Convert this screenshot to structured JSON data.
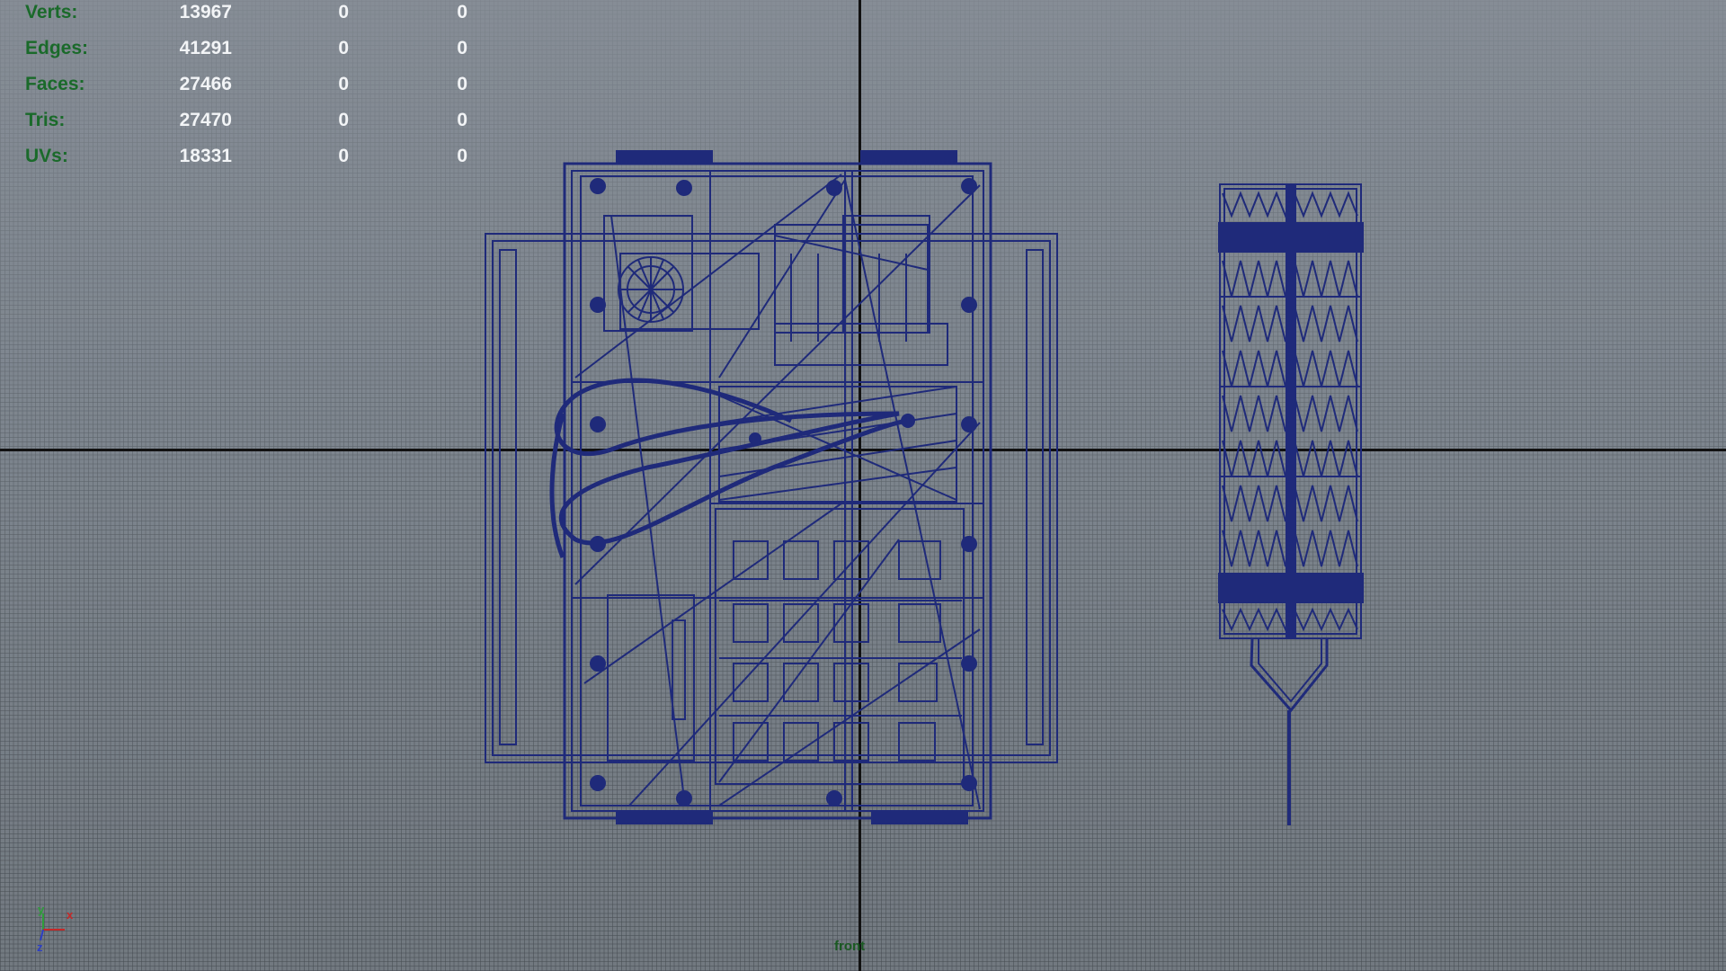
{
  "stats": [
    {
      "label": "Verts:",
      "total": "13967",
      "selected": "0",
      "component": "0"
    },
    {
      "label": "Edges:",
      "total": "41291",
      "selected": "0",
      "component": "0"
    },
    {
      "label": "Faces:",
      "total": "27466",
      "selected": "0",
      "component": "0"
    },
    {
      "label": "Tris:",
      "total": "27470",
      "selected": "0",
      "component": "0"
    },
    {
      "label": "UVs:",
      "total": "18331",
      "selected": "0",
      "component": "0"
    }
  ],
  "camera": {
    "label": "front"
  },
  "gizmo": {
    "y": "y",
    "x": "x",
    "z": "z"
  },
  "colors": {
    "wireframe": "#1f2a7a",
    "label_green": "#1a6a2a",
    "value_white": "#f2f4f6",
    "axis_x": "#c62828",
    "axis_y": "#2e9e3a",
    "axis_z": "#2c3ec4"
  },
  "icons": {
    "gizmo": "view-axis-icon"
  }
}
